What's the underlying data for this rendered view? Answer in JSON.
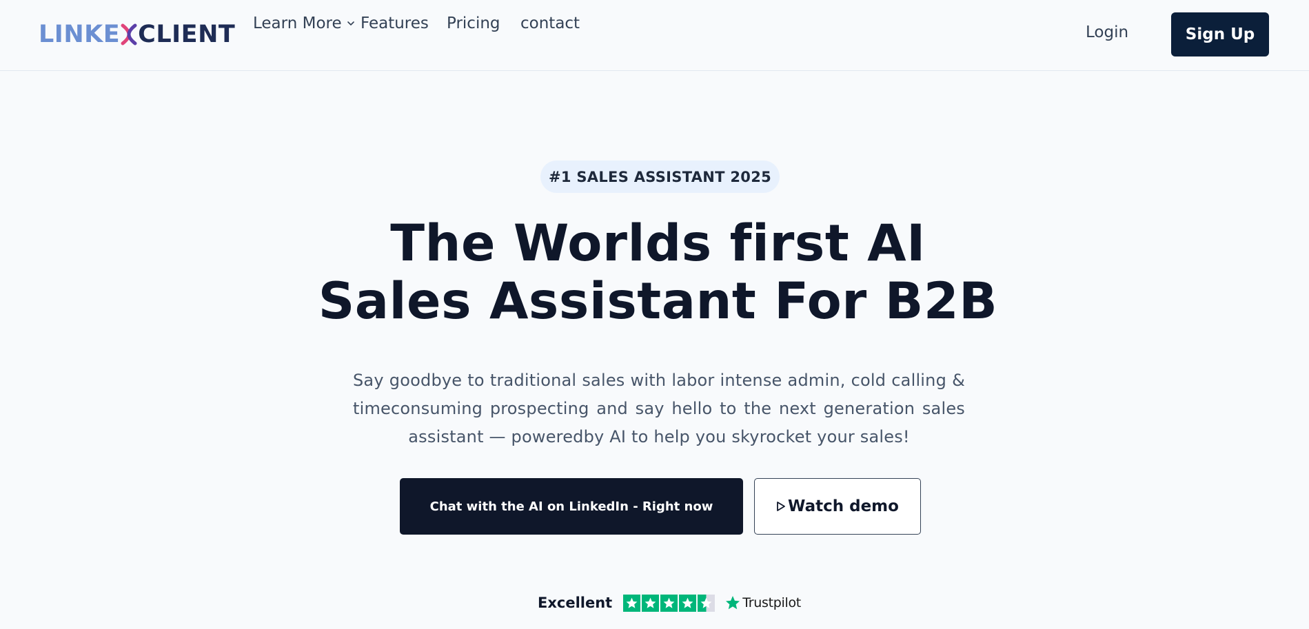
{
  "brand": {
    "logo_text_left": "LINKE",
    "logo_text_right": "CLIENT",
    "colors": {
      "logo_blue": "#6b8fd2",
      "logo_navy": "#1e2c55",
      "logo_pink": "#e0447a",
      "primary": "#0b1f3a"
    }
  },
  "nav": {
    "items": [
      {
        "label": "Learn More",
        "has_dropdown": true
      },
      {
        "label": "Features"
      },
      {
        "label": "Pricing"
      },
      {
        "label": "contact"
      }
    ],
    "login_label": "Login",
    "signup_label": "Sign Up"
  },
  "hero": {
    "badge": "#1 SALES ASSISTANT 2025",
    "headline_line1": "The Worlds first AI",
    "headline_line2": "Sales Assistant For B2B",
    "subtext": "Say goodbye to traditional sales with labor intense admin, cold calling & timeconsuming prospecting and say hello to the next generation sales assistant — poweredby AI to help you skyrocket your sales!",
    "cta_primary": "Chat with the AI on LinkedIn - Right now",
    "cta_secondary": "Watch demo"
  },
  "trustpilot": {
    "rating_label": "Excellent",
    "brand": "Trustpilot",
    "stars_filled": 4.5,
    "stars_total": 5,
    "star_color": "#00b67a"
  }
}
